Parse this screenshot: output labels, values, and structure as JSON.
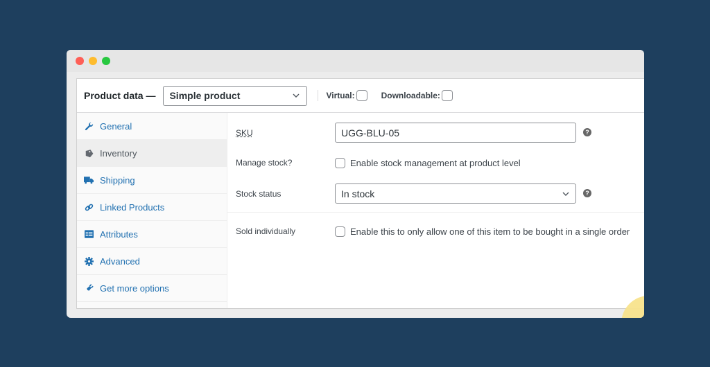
{
  "window": {
    "controls": [
      "close",
      "minimize",
      "maximize"
    ]
  },
  "header": {
    "title": "Product data —",
    "product_type": "Simple product",
    "virtual_label": "Virtual:",
    "virtual_checked": false,
    "downloadable_label": "Downloadable:",
    "downloadable_checked": false
  },
  "sidebar": {
    "items": [
      {
        "label": "General",
        "icon": "wrench-icon",
        "active": false
      },
      {
        "label": "Inventory",
        "icon": "tag-icon",
        "active": true
      },
      {
        "label": "Shipping",
        "icon": "truck-icon",
        "active": false
      },
      {
        "label": "Linked Products",
        "icon": "link-icon",
        "active": false
      },
      {
        "label": "Attributes",
        "icon": "table-icon",
        "active": false
      },
      {
        "label": "Advanced",
        "icon": "gear-icon",
        "active": false
      },
      {
        "label": "Get more options",
        "icon": "plug-icon",
        "active": false
      }
    ]
  },
  "inventory": {
    "sku_label": "SKU",
    "sku_value": "UGG-BLU-05",
    "manage_stock_label": "Manage stock?",
    "manage_stock_text": "Enable stock management at product level",
    "manage_stock_checked": false,
    "stock_status_label": "Stock status",
    "stock_status_value": "In stock",
    "sold_individually_label": "Sold individually",
    "sold_individually_text": "Enable this to only allow one of this item to be bought in a single order",
    "sold_individually_checked": false,
    "help_glyph": "?"
  },
  "colors": {
    "background": "#1e3f5e",
    "link": "#2271b1",
    "accent_blob": "#f8e38c"
  }
}
